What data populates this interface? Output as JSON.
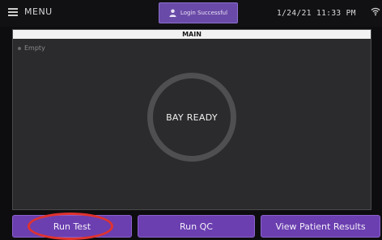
{
  "topbar": {
    "menu_label": "MENU",
    "login_status": "Login Successful",
    "datetime": "1/24/21 11:33 PM"
  },
  "main": {
    "header": "MAIN",
    "empty_label": "Empty",
    "bay_status": "BAY READY"
  },
  "actions": {
    "run_test": "Run Test",
    "run_qc": "Run QC",
    "view_patient_results": "View Patient Results"
  },
  "icons": {
    "menu": "hamburger-icon",
    "user": "user-icon",
    "wifi": "wifi-icon"
  },
  "colors": {
    "accent": "#6b3fb0",
    "highlight": "#e0322e",
    "panel": "#2b2b2d"
  }
}
